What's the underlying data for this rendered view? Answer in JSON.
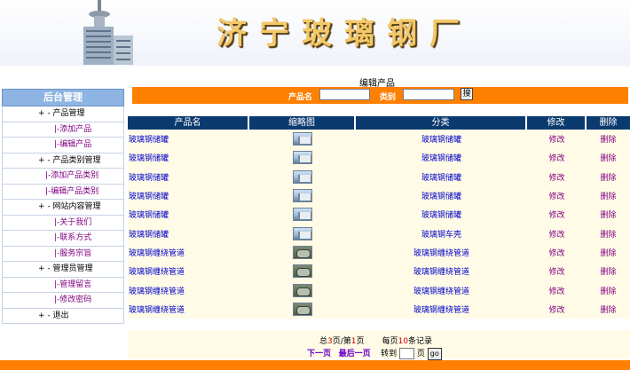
{
  "banner": {
    "title": "济宁玻璃钢厂"
  },
  "sidebar": {
    "header": "后台管理",
    "items": [
      {
        "label": "+ - 产品管理",
        "kind": "grp"
      },
      {
        "label": "|-添加产品",
        "kind": "sub"
      },
      {
        "label": "|-编辑产品",
        "kind": "sub"
      },
      {
        "label": "+ - 产品类别管理",
        "kind": "grp"
      },
      {
        "label": "|-添加产品类别",
        "kind": "sub-wide"
      },
      {
        "label": "|-编辑产品类别",
        "kind": "sub-wide"
      },
      {
        "label": "+ - 网站内容管理",
        "kind": "grp"
      },
      {
        "label": "|-关于我们",
        "kind": "sub"
      },
      {
        "label": "|-联系方式",
        "kind": "sub"
      },
      {
        "label": "|-服务宗旨",
        "kind": "sub"
      },
      {
        "label": "+ - 管理员管理",
        "kind": "grp"
      },
      {
        "label": "|-管理留言",
        "kind": "sub"
      },
      {
        "label": "|-修改密码",
        "kind": "sub"
      },
      {
        "label": "+ - 退出",
        "kind": "grp"
      }
    ]
  },
  "main": {
    "heading": "编辑产品",
    "search": {
      "name_label": "产品名",
      "category_label": "类别",
      "button_label": "搜"
    },
    "columns": [
      "产品名",
      "缩略图",
      "分类",
      "修改",
      "删除"
    ],
    "rows": [
      {
        "name": "玻璃钢储罐",
        "thumb": "tank",
        "category": "玻璃钢储罐",
        "edit": "修改",
        "del": "删除"
      },
      {
        "name": "玻璃钢储罐",
        "thumb": "tank",
        "category": "玻璃钢储罐",
        "edit": "修改",
        "del": "删除"
      },
      {
        "name": "玻璃钢储罐",
        "thumb": "tank",
        "category": "玻璃钢储罐",
        "edit": "修改",
        "del": "删除"
      },
      {
        "name": "玻璃钢储罐",
        "thumb": "tank",
        "category": "玻璃钢储罐",
        "edit": "修改",
        "del": "删除"
      },
      {
        "name": "玻璃钢储罐",
        "thumb": "tank",
        "category": "玻璃钢储罐",
        "edit": "修改",
        "del": "删除"
      },
      {
        "name": "玻璃钢储罐",
        "thumb": "tank",
        "category": "玻璃钢车壳",
        "edit": "修改",
        "del": "删除"
      },
      {
        "name": "玻璃钢缠绕管道",
        "thumb": "pipe",
        "category": "玻璃钢缠绕管道",
        "edit": "修改",
        "del": "删除"
      },
      {
        "name": "玻璃钢缠绕管道",
        "thumb": "pipe",
        "category": "玻璃钢缠绕管道",
        "edit": "修改",
        "del": "删除"
      },
      {
        "name": "玻璃钢缠绕管道",
        "thumb": "pipe",
        "category": "玻璃钢缠绕管道",
        "edit": "修改",
        "del": "删除"
      },
      {
        "name": "玻璃钢缠绕管道",
        "thumb": "pipe",
        "category": "玻璃钢缠绕管道",
        "edit": "修改",
        "del": "删除"
      }
    ]
  },
  "pager": {
    "total_prefix": "总",
    "total_pages": "3",
    "total_mid": "页/第",
    "current_page": "1",
    "total_suffix": "页",
    "per_page_prefix": "每页",
    "per_page": "10",
    "per_page_suffix": "条记录",
    "next": "下一页",
    "last": "最后一页",
    "goto": "转到",
    "page_unit": "页",
    "go": "go"
  },
  "colors": {
    "accent": "#ff7f00",
    "header_blue": "#0b3a6e",
    "sidebar_head": "#8db4e2",
    "row_bg": "#fffbe6"
  }
}
